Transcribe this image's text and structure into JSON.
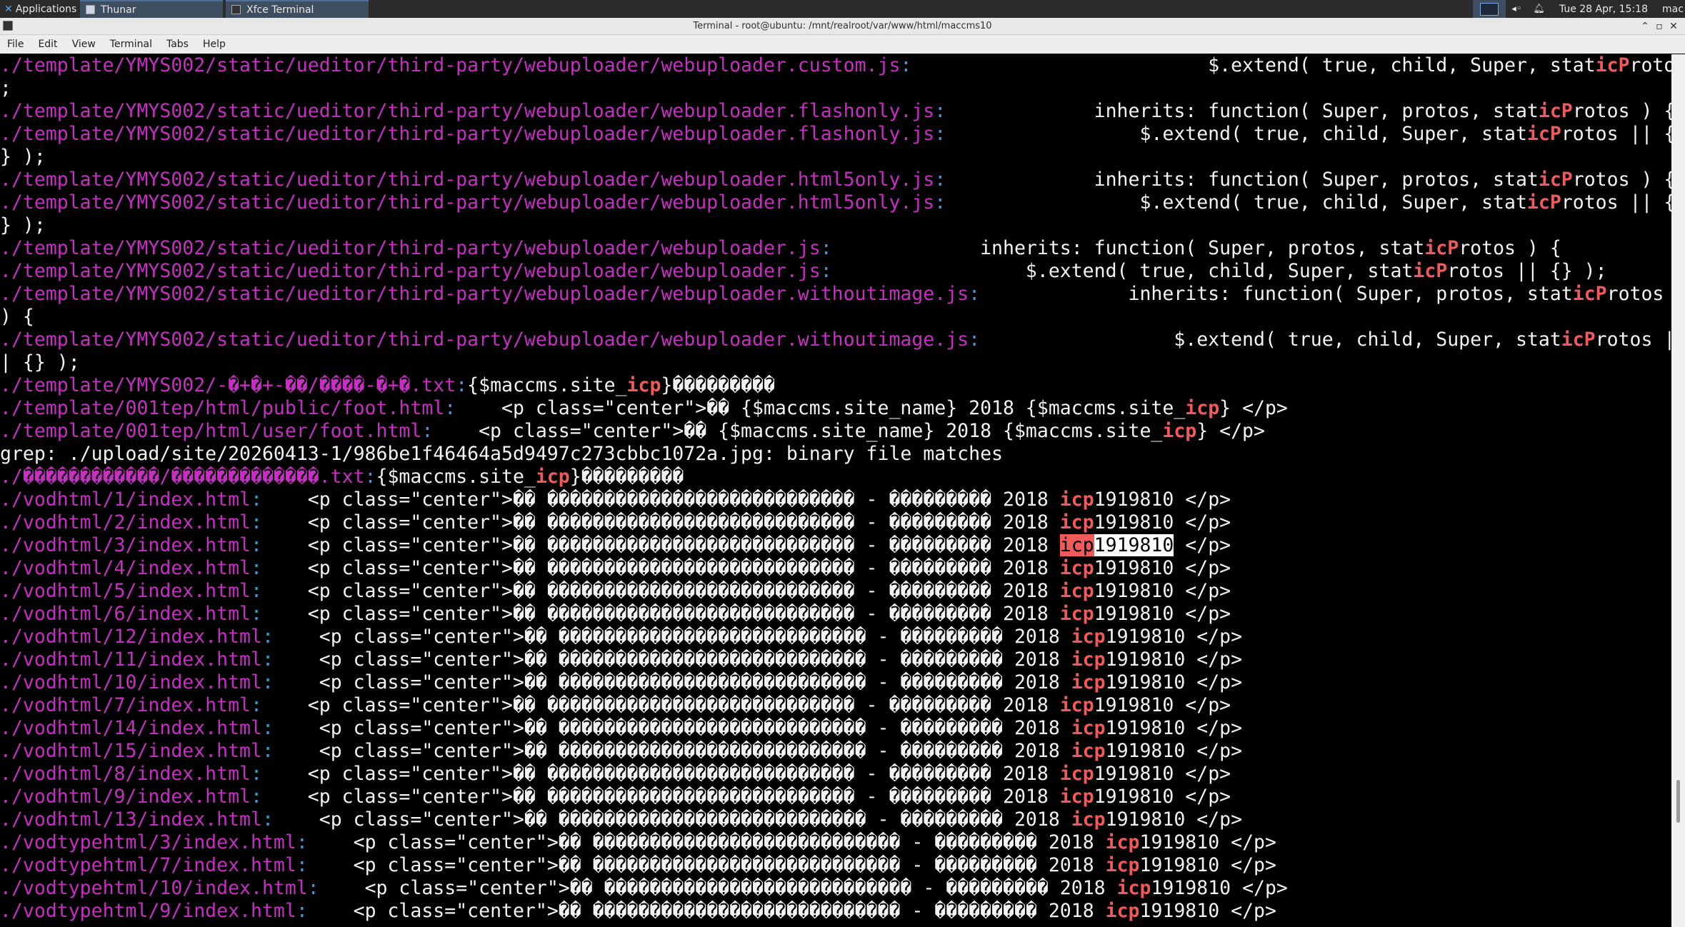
{
  "panel": {
    "apps_label": "Applications",
    "tasks": [
      {
        "label": "Thunar"
      },
      {
        "label": "Xfce Terminal"
      }
    ],
    "clock": "Tue 28 Apr, 15:18",
    "user": "mac"
  },
  "window": {
    "title": "Terminal - root@ubuntu: /mnt/realroot/var/www/html/maccms10",
    "controls": {
      "minimize": "⌃",
      "maximize": "▫",
      "close": "✕"
    }
  },
  "menubar": [
    "File",
    "Edit",
    "View",
    "Terminal",
    "Tabs",
    "Help"
  ],
  "terminal": {
    "lines": [
      [
        {
          "t": "./template/YMYS002/static/ueditor/third-party/webuploader/webuploader.custom.js",
          "c": "fn"
        },
        {
          "t": ":",
          "c": "sep"
        },
        {
          "t": "                          $.extend( true, child, Super, stat"
        },
        {
          "t": "icP",
          "c": "m"
        },
        {
          "t": "rotos || {} )"
        }
      ],
      [
        {
          "t": ";"
        }
      ],
      [
        {
          "t": "./template/YMYS002/static/ueditor/third-party/webuploader/webuploader.flashonly.js",
          "c": "fn"
        },
        {
          "t": ":",
          "c": "sep"
        },
        {
          "t": "             inherits: function( Super, protos, stat"
        },
        {
          "t": "icP",
          "c": "m"
        },
        {
          "t": "rotos ) {"
        }
      ],
      [
        {
          "t": "./template/YMYS002/static/ueditor/third-party/webuploader/webuploader.flashonly.js",
          "c": "fn"
        },
        {
          "t": ":",
          "c": "sep"
        },
        {
          "t": "                 $.extend( true, child, Super, stat"
        },
        {
          "t": "icP",
          "c": "m"
        },
        {
          "t": "rotos || {"
        }
      ],
      [
        {
          "t": "} );"
        }
      ],
      [
        {
          "t": "./template/YMYS002/static/ueditor/third-party/webuploader/webuploader.html5only.js",
          "c": "fn"
        },
        {
          "t": ":",
          "c": "sep"
        },
        {
          "t": "             inherits: function( Super, protos, stat"
        },
        {
          "t": "icP",
          "c": "m"
        },
        {
          "t": "rotos ) {"
        }
      ],
      [
        {
          "t": "./template/YMYS002/static/ueditor/third-party/webuploader/webuploader.html5only.js",
          "c": "fn"
        },
        {
          "t": ":",
          "c": "sep"
        },
        {
          "t": "                 $.extend( true, child, Super, stat"
        },
        {
          "t": "icP",
          "c": "m"
        },
        {
          "t": "rotos || {"
        }
      ],
      [
        {
          "t": "} );"
        }
      ],
      [
        {
          "t": "./template/YMYS002/static/ueditor/third-party/webuploader/webuploader.js",
          "c": "fn"
        },
        {
          "t": ":",
          "c": "sep"
        },
        {
          "t": "             inherits: function( Super, protos, stat"
        },
        {
          "t": "icP",
          "c": "m"
        },
        {
          "t": "rotos ) {"
        }
      ],
      [
        {
          "t": "./template/YMYS002/static/ueditor/third-party/webuploader/webuploader.js",
          "c": "fn"
        },
        {
          "t": ":",
          "c": "sep"
        },
        {
          "t": "                 $.extend( true, child, Super, stat"
        },
        {
          "t": "icP",
          "c": "m"
        },
        {
          "t": "rotos || {} );"
        }
      ],
      [
        {
          "t": "./template/YMYS002/static/ueditor/third-party/webuploader/webuploader.withoutimage.js",
          "c": "fn"
        },
        {
          "t": ":",
          "c": "sep"
        },
        {
          "t": "             inherits: function( Super, protos, stat"
        },
        {
          "t": "icP",
          "c": "m"
        },
        {
          "t": "rotos"
        }
      ],
      [
        {
          "t": ") {"
        }
      ],
      [
        {
          "t": "./template/YMYS002/static/ueditor/third-party/webuploader/webuploader.withoutimage.js",
          "c": "fn"
        },
        {
          "t": ":",
          "c": "sep"
        },
        {
          "t": "                 $.extend( true, child, Super, stat"
        },
        {
          "t": "icP",
          "c": "m"
        },
        {
          "t": "rotos |"
        }
      ],
      [
        {
          "t": "| {} );"
        }
      ],
      [
        {
          "t": "./template/YMYS002/-�+�+-��/����-�+�.txt",
          "c": "fn"
        },
        {
          "t": ":",
          "c": "sep"
        },
        {
          "t": "{$maccms.site_"
        },
        {
          "t": "icp",
          "c": "m"
        },
        {
          "t": "}���������"
        }
      ],
      [
        {
          "t": "./template/001tep/html/public/foot.html",
          "c": "fn"
        },
        {
          "t": ":",
          "c": "sep"
        },
        {
          "t": "    <p class=\"center\">�� {$maccms.site_name} 2018 {$maccms.site_"
        },
        {
          "t": "icp",
          "c": "m"
        },
        {
          "t": "} </p>"
        }
      ],
      [
        {
          "t": "./template/001tep/html/user/foot.html",
          "c": "fn"
        },
        {
          "t": ":",
          "c": "sep"
        },
        {
          "t": "    <p class=\"center\">�� {$maccms.site_name} 2018 {$maccms.site_"
        },
        {
          "t": "icp",
          "c": "m"
        },
        {
          "t": "} </p>"
        }
      ],
      [
        {
          "t": "grep: ./upload/site/20260413-1/986be1f46464a5d9497c273cbbc1072a.jpg: binary file matches"
        }
      ],
      [
        {
          "t": "./������������/�������������.txt",
          "c": "fn"
        },
        {
          "t": ":",
          "c": "sep"
        },
        {
          "t": "{$maccms.site_"
        },
        {
          "t": "icp",
          "c": "m"
        },
        {
          "t": "}���������"
        }
      ],
      [
        {
          "t": "./vodhtml/1/index.html",
          "c": "fn"
        },
        {
          "t": ":",
          "c": "sep"
        },
        {
          "t": "    <p class=\"center\">�� ��������������������������� - ��������� 2018 "
        },
        {
          "t": "icp",
          "c": "m"
        },
        {
          "t": "1919810 </p>"
        }
      ],
      [
        {
          "t": "./vodhtml/2/index.html",
          "c": "fn"
        },
        {
          "t": ":",
          "c": "sep"
        },
        {
          "t": "    <p class=\"center\">�� ��������������������������� - ��������� 2018 "
        },
        {
          "t": "icp",
          "c": "m"
        },
        {
          "t": "1919810 </p>"
        }
      ],
      [
        {
          "t": "./vodhtml/3/index.html",
          "c": "fn"
        },
        {
          "t": ":",
          "c": "sep"
        },
        {
          "t": "    <p class=\"center\">�� ��������������������������� - ��������� 2018 "
        },
        {
          "t": "icp",
          "c": "hl"
        },
        {
          "t": "1919810",
          "c": "sel"
        },
        {
          "t": " </p>"
        }
      ],
      [
        {
          "t": "./vodhtml/4/index.html",
          "c": "fn"
        },
        {
          "t": ":",
          "c": "sep"
        },
        {
          "t": "    <p class=\"center\">�� ��������������������������� - ��������� 2018 "
        },
        {
          "t": "icp",
          "c": "m"
        },
        {
          "t": "1919810 </p>"
        }
      ],
      [
        {
          "t": "./vodhtml/5/index.html",
          "c": "fn"
        },
        {
          "t": ":",
          "c": "sep"
        },
        {
          "t": "    <p class=\"center\">�� ��������������������������� - ��������� 2018 "
        },
        {
          "t": "icp",
          "c": "m"
        },
        {
          "t": "1919810 </p>"
        }
      ],
      [
        {
          "t": "./vodhtml/6/index.html",
          "c": "fn"
        },
        {
          "t": ":",
          "c": "sep"
        },
        {
          "t": "    <p class=\"center\">�� ��������������������������� - ��������� 2018 "
        },
        {
          "t": "icp",
          "c": "m"
        },
        {
          "t": "1919810 </p>"
        }
      ],
      [
        {
          "t": "./vodhtml/12/index.html",
          "c": "fn"
        },
        {
          "t": ":",
          "c": "sep"
        },
        {
          "t": "    <p class=\"center\">�� ��������������������������� - ��������� 2018 "
        },
        {
          "t": "icp",
          "c": "m"
        },
        {
          "t": "1919810 </p>"
        }
      ],
      [
        {
          "t": "./vodhtml/11/index.html",
          "c": "fn"
        },
        {
          "t": ":",
          "c": "sep"
        },
        {
          "t": "    <p class=\"center\">�� ��������������������������� - ��������� 2018 "
        },
        {
          "t": "icp",
          "c": "m"
        },
        {
          "t": "1919810 </p>"
        }
      ],
      [
        {
          "t": "./vodhtml/10/index.html",
          "c": "fn"
        },
        {
          "t": ":",
          "c": "sep"
        },
        {
          "t": "    <p class=\"center\">�� ��������������������������� - ��������� 2018 "
        },
        {
          "t": "icp",
          "c": "m"
        },
        {
          "t": "1919810 </p>"
        }
      ],
      [
        {
          "t": "./vodhtml/7/index.html",
          "c": "fn"
        },
        {
          "t": ":",
          "c": "sep"
        },
        {
          "t": "    <p class=\"center\">�� ��������������������������� - ��������� 2018 "
        },
        {
          "t": "icp",
          "c": "m"
        },
        {
          "t": "1919810 </p>"
        }
      ],
      [
        {
          "t": "./vodhtml/14/index.html",
          "c": "fn"
        },
        {
          "t": ":",
          "c": "sep"
        },
        {
          "t": "    <p class=\"center\">�� ��������������������������� - ��������� 2018 "
        },
        {
          "t": "icp",
          "c": "m"
        },
        {
          "t": "1919810 </p>"
        }
      ],
      [
        {
          "t": "./vodhtml/15/index.html",
          "c": "fn"
        },
        {
          "t": ":",
          "c": "sep"
        },
        {
          "t": "    <p class=\"center\">�� ��������������������������� - ��������� 2018 "
        },
        {
          "t": "icp",
          "c": "m"
        },
        {
          "t": "1919810 </p>"
        }
      ],
      [
        {
          "t": "./vodhtml/8/index.html",
          "c": "fn"
        },
        {
          "t": ":",
          "c": "sep"
        },
        {
          "t": "    <p class=\"center\">�� ��������������������������� - ��������� 2018 "
        },
        {
          "t": "icp",
          "c": "m"
        },
        {
          "t": "1919810 </p>"
        }
      ],
      [
        {
          "t": "./vodhtml/9/index.html",
          "c": "fn"
        },
        {
          "t": ":",
          "c": "sep"
        },
        {
          "t": "    <p class=\"center\">�� ��������������������������� - ��������� 2018 "
        },
        {
          "t": "icp",
          "c": "m"
        },
        {
          "t": "1919810 </p>"
        }
      ],
      [
        {
          "t": "./vodhtml/13/index.html",
          "c": "fn"
        },
        {
          "t": ":",
          "c": "sep"
        },
        {
          "t": "    <p class=\"center\">�� ��������������������������� - ��������� 2018 "
        },
        {
          "t": "icp",
          "c": "m"
        },
        {
          "t": "1919810 </p>"
        }
      ],
      [
        {
          "t": "./vodtypehtml/3/index.html",
          "c": "fn"
        },
        {
          "t": ":",
          "c": "sep"
        },
        {
          "t": "    <p class=\"center\">�� ��������������������������� - ��������� 2018 "
        },
        {
          "t": "icp",
          "c": "m"
        },
        {
          "t": "1919810 </p>"
        }
      ],
      [
        {
          "t": "./vodtypehtml/7/index.html",
          "c": "fn"
        },
        {
          "t": ":",
          "c": "sep"
        },
        {
          "t": "    <p class=\"center\">�� ��������������������������� - ��������� 2018 "
        },
        {
          "t": "icp",
          "c": "m"
        },
        {
          "t": "1919810 </p>"
        }
      ],
      [
        {
          "t": "./vodtypehtml/10/index.html",
          "c": "fn"
        },
        {
          "t": ":",
          "c": "sep"
        },
        {
          "t": "    <p class=\"center\">�� ��������������������������� - ��������� 2018 "
        },
        {
          "t": "icp",
          "c": "m"
        },
        {
          "t": "1919810 </p>"
        }
      ],
      [
        {
          "t": "./vodtypehtml/9/index.html",
          "c": "fn"
        },
        {
          "t": ":",
          "c": "sep"
        },
        {
          "t": "    <p class=\"center\">�� ��������������������������� - ��������� 2018 "
        },
        {
          "t": "icp",
          "c": "m"
        },
        {
          "t": "1919810 </p>"
        }
      ]
    ]
  },
  "colors": {
    "filename": "#c62fc2",
    "separator": "#3a9ad9",
    "match": "#ef5b5b",
    "text": "#f2f2f2",
    "background": "#000000"
  }
}
